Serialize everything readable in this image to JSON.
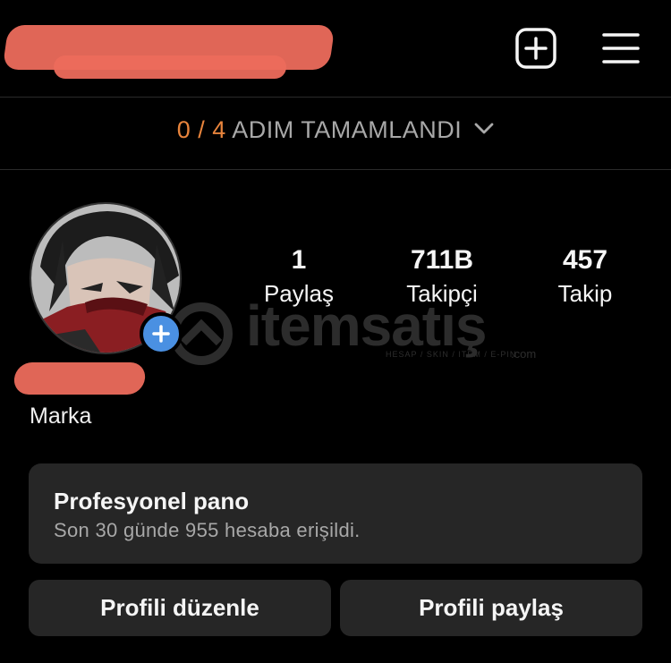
{
  "header": {
    "icons": [
      "plus-square-icon",
      "hamburger-menu-icon"
    ]
  },
  "steps_banner": {
    "progress": "0 / 4",
    "label": "ADIM TAMAMLANDI",
    "icon": "chevron-down-icon"
  },
  "profile": {
    "avatar_icon": "profile-avatar",
    "add_icon": "plus-icon",
    "category": "Marka"
  },
  "stats": [
    {
      "value": "1",
      "label": "Paylaş"
    },
    {
      "value": "711B",
      "label": "Takipçi"
    },
    {
      "value": "457",
      "label": "Takip"
    }
  ],
  "watermark": {
    "text": "itemsatış",
    "subtext": "HESAP / SKIN / ITEM / E-PIN",
    "suffix": ".com"
  },
  "pro_dashboard": {
    "title": "Profesyonel pano",
    "subtitle": "Son 30 günde 955 hesaba erişildi."
  },
  "actions": {
    "edit_profile": "Profili düzenle",
    "share_profile": "Profili paylaş"
  },
  "colors": {
    "background": "#000000",
    "accent_orange": "#e8843c",
    "blue_badge": "#4a90e2",
    "card": "#262626"
  }
}
